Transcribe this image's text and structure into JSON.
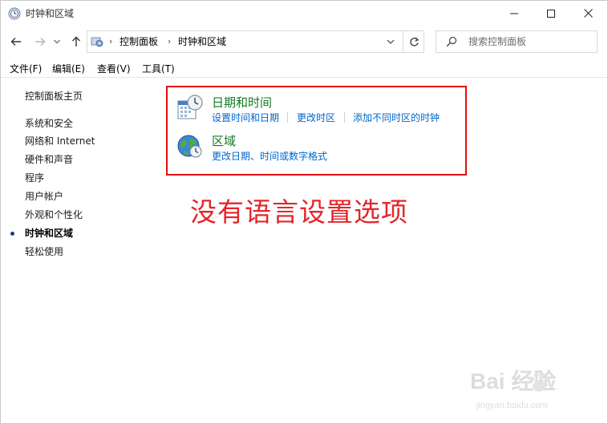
{
  "window": {
    "title": "时钟和区域"
  },
  "address": {
    "crumbs": [
      "控制面板",
      "时钟和区域"
    ],
    "search_placeholder": "搜索控制面板"
  },
  "menu": [
    "文件(F)",
    "编辑(E)",
    "查看(V)",
    "工具(T)"
  ],
  "sidebar": {
    "home": "控制面板主页",
    "items": [
      {
        "label": "系统和安全",
        "active": false
      },
      {
        "label": "网络和 Internet",
        "active": false
      },
      {
        "label": "硬件和声音",
        "active": false
      },
      {
        "label": "程序",
        "active": false
      },
      {
        "label": "用户帐户",
        "active": false
      },
      {
        "label": "外观和个性化",
        "active": false
      },
      {
        "label": "时钟和区域",
        "active": true
      },
      {
        "label": "轻松使用",
        "active": false
      }
    ]
  },
  "categories": [
    {
      "title": "日期和时间",
      "icon": "calendar-clock-icon",
      "links": [
        "设置时间和日期",
        "更改时区",
        "添加不同时区的时钟"
      ]
    },
    {
      "title": "区域",
      "icon": "globe-clock-icon",
      "links": [
        "更改日期、时间或数字格式"
      ]
    }
  ],
  "annotation": "没有语言设置选项",
  "watermark": {
    "logo": "Bai  经验",
    "url": "jingyan.baidu.com"
  },
  "colors": {
    "category_title": "#0f7a21",
    "link": "#0066cc",
    "annotation": "#e3262b",
    "highlight_border": "#e01010"
  }
}
